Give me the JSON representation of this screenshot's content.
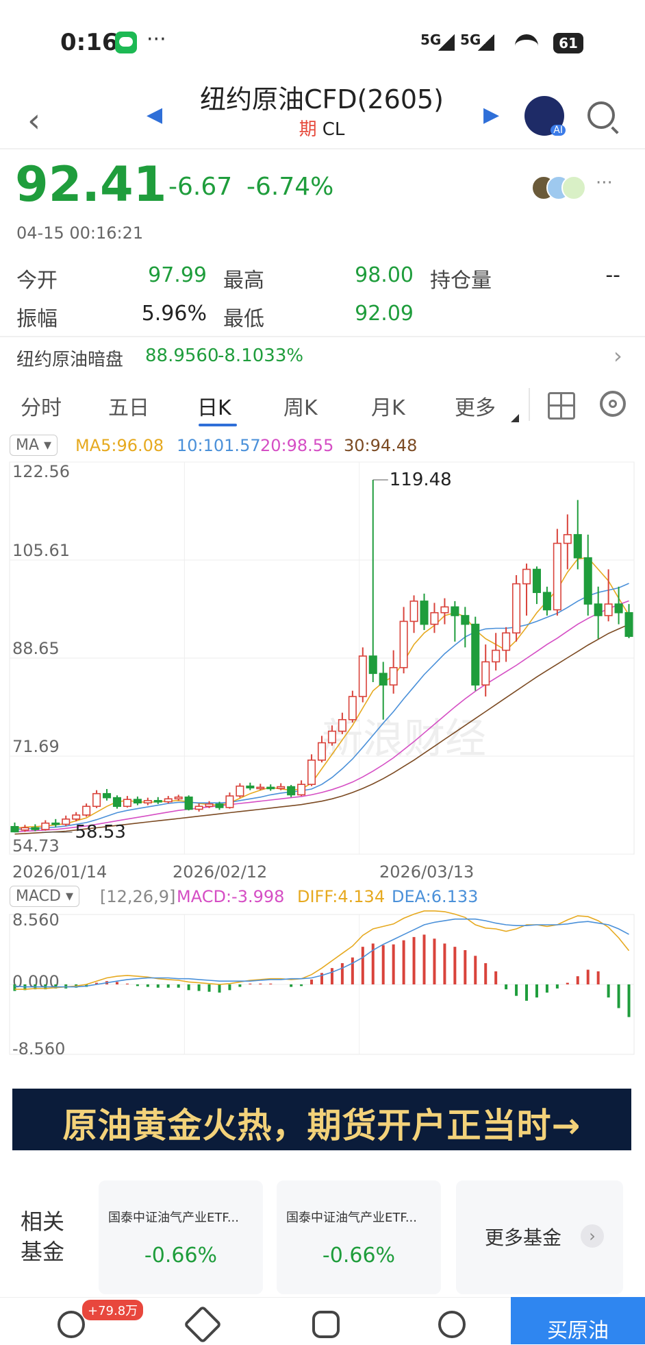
{
  "status_bar": {
    "time": "0:16",
    "signal1": "5G",
    "signal2": "5G",
    "battery": "61",
    "more": "···"
  },
  "header": {
    "title": "纽约原油CFD(2605)",
    "badge": "期",
    "code": "CL"
  },
  "quote": {
    "price": "92.41",
    "change": "-6.67",
    "change_pct": "-6.74%",
    "timestamp": "04-15 00:16:21",
    "more": "···",
    "open_label": "今开",
    "open": "97.99",
    "high_label": "最高",
    "high": "98.00",
    "oi_label": "持仓量",
    "oi": "--",
    "amp_label": "振幅",
    "amp": "5.96%",
    "low_label": "最低",
    "low": "92.09"
  },
  "dark_pool": {
    "label": "纽约原油暗盘",
    "value": "88.9560",
    "change": "-8.1033%"
  },
  "tabs": [
    "分时",
    "五日",
    "日K",
    "周K",
    "月K",
    "更多"
  ],
  "ma_legend": {
    "selector": "MA",
    "ma5": "MA5:96.08",
    "ma10": "10:101.57",
    "ma20": "20:98.55",
    "ma30": "30:94.48"
  },
  "macd_legend": {
    "selector": "MACD",
    "params": "[12,26,9]",
    "macd": "MACD:-3.998",
    "diff": "DIFF:4.134",
    "dea": "DEA:6.133"
  },
  "colors": {
    "up": "#d9433b",
    "down": "#1f9d3c",
    "ma5": "#e6a91f",
    "ma10": "#4a90d9",
    "ma20": "#d54ec4",
    "ma30": "#7b4a22"
  },
  "chart_data": {
    "type": "candlestick",
    "ylim": [
      54.73,
      122.56
    ],
    "y_ticks": [
      "122.56",
      "105.61",
      "88.65",
      "71.69",
      "54.73"
    ],
    "x_ticks": [
      "2026/01/14",
      "2026/02/12",
      "2026/03/13"
    ],
    "max_label": "119.48",
    "min_label": "58.53",
    "watermark": "新浪财经",
    "candles": [
      [
        59.5,
        58.6,
        60.2,
        58.5
      ],
      [
        58.9,
        59.3,
        59.8,
        58.6
      ],
      [
        59.3,
        59.0,
        59.9,
        58.7
      ],
      [
        59.0,
        60.1,
        60.6,
        58.8
      ],
      [
        60.1,
        59.9,
        60.8,
        59.4
      ],
      [
        59.9,
        60.8,
        61.4,
        59.6
      ],
      [
        60.8,
        61.5,
        62.0,
        60.4
      ],
      [
        61.5,
        63.0,
        63.5,
        61.2
      ],
      [
        63.0,
        65.2,
        65.8,
        62.7
      ],
      [
        65.2,
        64.5,
        66.0,
        64.0
      ],
      [
        64.5,
        63.0,
        64.9,
        62.6
      ],
      [
        63.0,
        64.2,
        64.8,
        62.8
      ],
      [
        64.2,
        63.6,
        64.7,
        63.2
      ],
      [
        63.6,
        64.0,
        64.5,
        63.2
      ],
      [
        64.0,
        63.8,
        64.6,
        63.4
      ],
      [
        63.8,
        64.3,
        64.8,
        63.5
      ],
      [
        64.3,
        64.6,
        65.0,
        64.0
      ],
      [
        64.6,
        62.5,
        64.9,
        62.3
      ],
      [
        62.5,
        63.0,
        63.5,
        62.1
      ],
      [
        63.0,
        63.4,
        63.9,
        62.7
      ],
      [
        63.4,
        62.8,
        63.8,
        62.4
      ],
      [
        62.8,
        64.8,
        65.4,
        62.6
      ],
      [
        64.8,
        66.5,
        67.0,
        64.5
      ],
      [
        66.5,
        66.2,
        67.1,
        65.8
      ],
      [
        66.2,
        66.3,
        66.9,
        65.8
      ],
      [
        66.3,
        66.1,
        66.8,
        65.7
      ],
      [
        66.1,
        66.4,
        67.0,
        65.8
      ],
      [
        66.4,
        65.0,
        66.7,
        64.6
      ],
      [
        65.0,
        66.8,
        67.5,
        64.8
      ],
      [
        66.8,
        71.0,
        72.0,
        66.5
      ],
      [
        71.0,
        74.0,
        75.2,
        70.6
      ],
      [
        74.0,
        76.0,
        77.0,
        73.5
      ],
      [
        76.0,
        78.0,
        79.2,
        75.5
      ],
      [
        78.0,
        82.0,
        83.0,
        77.5
      ],
      [
        82.0,
        89.0,
        90.5,
        81.0
      ],
      [
        89.0,
        86.0,
        119.48,
        84.5
      ],
      [
        86.0,
        84.0,
        88.0,
        78.0
      ],
      [
        84.0,
        87.0,
        90.0,
        82.5
      ],
      [
        87.0,
        95.0,
        97.5,
        86.0
      ],
      [
        95.0,
        98.5,
        99.5,
        93.0
      ],
      [
        98.5,
        94.5,
        99.8,
        93.5
      ],
      [
        94.5,
        96.5,
        98.2,
        93.0
      ],
      [
        96.5,
        97.5,
        99.0,
        94.5
      ],
      [
        97.5,
        96.0,
        98.5,
        91.5
      ],
      [
        96.0,
        94.5,
        97.5,
        90.5
      ],
      [
        94.5,
        84.0,
        95.8,
        83.0
      ],
      [
        84.0,
        88.0,
        91.0,
        82.0
      ],
      [
        88.0,
        90.0,
        93.0,
        86.5
      ],
      [
        90.0,
        93.0,
        94.0,
        88.0
      ],
      [
        93.0,
        101.5,
        103.0,
        91.5
      ],
      [
        101.5,
        104.0,
        105.0,
        96.0
      ],
      [
        104.0,
        100.0,
        104.5,
        98.0
      ],
      [
        100.0,
        97.0,
        101.0,
        96.0
      ],
      [
        97.0,
        108.5,
        111.0,
        96.0
      ],
      [
        108.5,
        110.0,
        113.5,
        104.0
      ],
      [
        110.0,
        106.0,
        116.0,
        104.0
      ],
      [
        106.0,
        98.0,
        110.0,
        96.0
      ],
      [
        98.0,
        96.0,
        101.0,
        92.0
      ],
      [
        96.0,
        98.0,
        104.0,
        95.0
      ],
      [
        98.0,
        96.5,
        101.0,
        94.5
      ],
      [
        96.5,
        92.41,
        98.0,
        92.09
      ]
    ],
    "ma_series": {
      "MA5": [
        59.2,
        59.4,
        59.5,
        59.6,
        59.8,
        60.0,
        60.5,
        61.0,
        62.0,
        63.0,
        63.8,
        64.0,
        63.8,
        63.7,
        63.8,
        63.9,
        64.0,
        63.8,
        63.5,
        63.3,
        63.2,
        63.6,
        64.4,
        65.2,
        65.8,
        66.3,
        66.0,
        65.8,
        66.0,
        67.0,
        69.5,
        72.0,
        74.5,
        77.0,
        80.0,
        83.0,
        84.5,
        85.5,
        88.0,
        91.0,
        93.0,
        94.3,
        96.0,
        96.5,
        95.8,
        93.5,
        92.0,
        91.0,
        90.0,
        91.7,
        94.0,
        96.5,
        98.5,
        100.5,
        103.5,
        105.8,
        106.0,
        104.0,
        102.0,
        99.0,
        96.08
      ],
      "MA10": [
        59.0,
        59.1,
        59.2,
        59.3,
        59.4,
        59.6,
        59.9,
        60.2,
        60.7,
        61.3,
        61.9,
        62.3,
        62.6,
        62.9,
        63.2,
        63.5,
        63.7,
        63.7,
        63.6,
        63.6,
        63.6,
        63.7,
        64.0,
        64.3,
        64.6,
        65.0,
        65.3,
        65.5,
        65.7,
        66.0,
        66.8,
        68.0,
        69.5,
        71.2,
        73.2,
        75.3,
        77.4,
        79.4,
        81.6,
        83.7,
        85.8,
        87.6,
        89.4,
        90.9,
        92.3,
        93.2,
        93.7,
        93.8,
        93.8,
        94.0,
        94.4,
        95.0,
        95.7,
        96.4,
        97.4,
        98.5,
        99.4,
        100.0,
        100.4,
        100.8,
        101.57
      ],
      "MA20": [
        58.6,
        58.7,
        58.8,
        58.9,
        59.0,
        59.2,
        59.4,
        59.6,
        59.9,
        60.2,
        60.5,
        60.8,
        61.1,
        61.4,
        61.7,
        62.0,
        62.3,
        62.5,
        62.7,
        62.9,
        63.1,
        63.3,
        63.5,
        63.7,
        63.9,
        64.1,
        64.3,
        64.5,
        64.7,
        65.0,
        65.4,
        65.9,
        66.5,
        67.2,
        68.1,
        69.1,
        70.2,
        71.4,
        72.8,
        74.2,
        75.7,
        77.2,
        78.7,
        80.2,
        81.6,
        82.9,
        84.1,
        85.2,
        86.3,
        87.4,
        88.6,
        89.8,
        91.0,
        92.1,
        93.3,
        94.5,
        95.5,
        96.4,
        97.2,
        97.9,
        98.55
      ],
      "MA30": [
        58.2,
        58.3,
        58.4,
        58.5,
        58.6,
        58.7,
        58.9,
        59.1,
        59.3,
        59.5,
        59.7,
        59.9,
        60.1,
        60.3,
        60.5,
        60.7,
        60.9,
        61.1,
        61.3,
        61.5,
        61.7,
        61.9,
        62.1,
        62.3,
        62.5,
        62.7,
        62.9,
        63.1,
        63.3,
        63.6,
        63.9,
        64.3,
        64.8,
        65.4,
        66.1,
        66.9,
        67.8,
        68.8,
        69.9,
        71.0,
        72.2,
        73.4,
        74.6,
        75.8,
        77.0,
        78.2,
        79.4,
        80.6,
        81.8,
        83.0,
        84.2,
        85.4,
        86.5,
        87.6,
        88.7,
        89.8,
        90.9,
        91.9,
        92.9,
        93.7,
        94.48
      ]
    },
    "macd_panel": {
      "ylim": [
        -8.56,
        8.56
      ],
      "y_ticks": [
        "8.560",
        "0.000",
        "-8.560"
      ],
      "hist": [
        -0.8,
        -0.7,
        -0.6,
        -0.6,
        -0.5,
        -0.5,
        -0.4,
        -0.3,
        0.2,
        0.4,
        0.3,
        0.1,
        -0.2,
        -0.3,
        -0.4,
        -0.4,
        -0.4,
        -0.7,
        -0.8,
        -0.9,
        -1.0,
        -0.7,
        -0.3,
        0.1,
        0.1,
        0.1,
        0.0,
        -0.3,
        -0.2,
        0.6,
        1.4,
        2.0,
        2.6,
        3.3,
        4.6,
        5.0,
        4.8,
        4.9,
        5.4,
        5.8,
        6.1,
        5.6,
        5.0,
        4.6,
        4.2,
        3.5,
        2.6,
        1.6,
        -0.6,
        -1.4,
        -2.0,
        -1.6,
        -1.0,
        -0.5,
        0.2,
        1.0,
        1.8,
        1.6,
        -1.6,
        -2.9,
        -3.998
      ],
      "diff": [
        -0.6,
        -0.6,
        -0.5,
        -0.5,
        -0.4,
        -0.3,
        -0.2,
        0.0,
        0.4,
        0.8,
        1.0,
        1.1,
        1.0,
        0.9,
        0.7,
        0.6,
        0.5,
        0.3,
        0.2,
        0.1,
        0.0,
        0.1,
        0.3,
        0.5,
        0.6,
        0.7,
        0.7,
        0.6,
        0.7,
        1.2,
        2.0,
        2.9,
        3.8,
        4.7,
        6.0,
        6.8,
        7.1,
        7.4,
        8.1,
        8.6,
        9.0,
        9.0,
        8.9,
        8.6,
        8.2,
        7.3,
        6.9,
        6.8,
        6.5,
        6.8,
        7.3,
        7.3,
        7.1,
        7.3,
        7.9,
        8.4,
        8.3,
        7.8,
        7.0,
        5.7,
        4.134
      ],
      "dea": [
        -0.2,
        -0.3,
        -0.3,
        -0.3,
        -0.3,
        -0.3,
        -0.3,
        -0.2,
        0.0,
        0.2,
        0.4,
        0.6,
        0.7,
        0.8,
        0.8,
        0.8,
        0.7,
        0.7,
        0.6,
        0.5,
        0.4,
        0.4,
        0.4,
        0.4,
        0.5,
        0.6,
        0.6,
        0.7,
        0.7,
        0.8,
        1.1,
        1.5,
        2.0,
        2.6,
        3.3,
        4.2,
        4.9,
        5.5,
        6.1,
        6.7,
        7.3,
        7.6,
        7.8,
        8.0,
        8.0,
        8.0,
        7.8,
        7.5,
        7.3,
        7.2,
        7.2,
        7.3,
        7.3,
        7.3,
        7.4,
        7.6,
        7.7,
        7.5,
        7.3,
        6.8,
        6.133
      ]
    }
  },
  "banner": {
    "text": "原油黄金火热，期货开户正当时→"
  },
  "funds": {
    "label": "相关基金",
    "items": [
      {
        "name": "国泰中证油气产业ETF...",
        "pct": "-0.66%"
      },
      {
        "name": "国泰中证油气产业ETF...",
        "pct": "-0.66%"
      }
    ],
    "more": "更多基金"
  },
  "bottom_bar": {
    "badge": "+79.8万",
    "buy": "买原油"
  }
}
